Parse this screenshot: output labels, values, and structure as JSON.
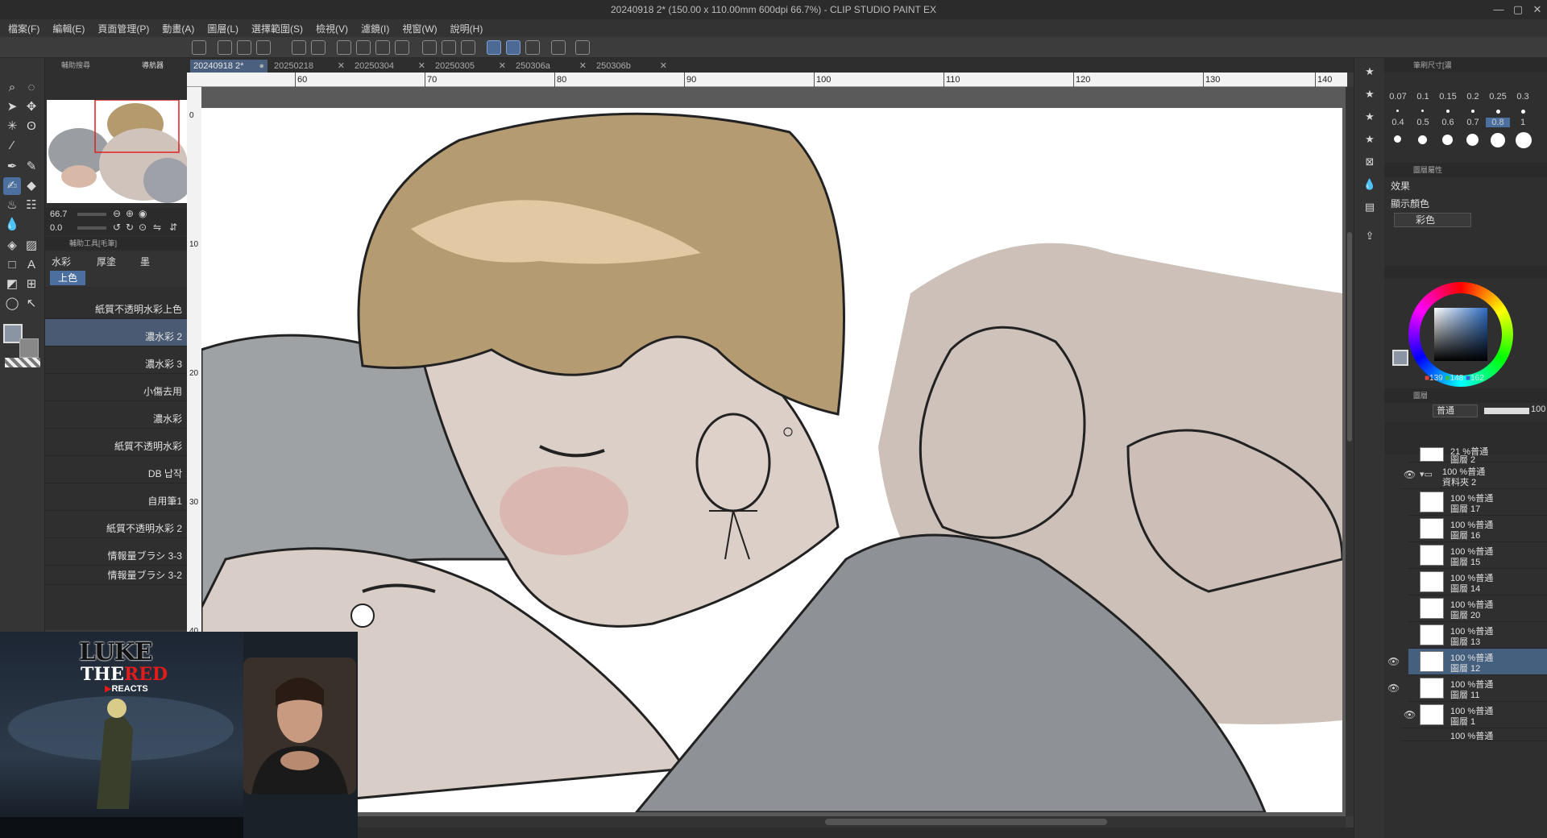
{
  "window": {
    "title": "20240918 2* (150.00 x 110.00mm 600dpi 66.7%) - CLIP STUDIO PAINT EX",
    "controls": [
      "—",
      "▢",
      "✕"
    ]
  },
  "menu": [
    "檔案(F)",
    "編輯(E)",
    "頁面管理(P)",
    "動畫(A)",
    "圖層(L)",
    "選擇範圍(S)",
    "檢視(V)",
    "濾鏡(I)",
    "視窗(W)",
    "說明(H)"
  ],
  "left_panel": {
    "tabs": [
      "輔助搜尋",
      "導航器"
    ],
    "navigator": {
      "zoom": "66.7",
      "rotation": "0.0"
    },
    "subtool_header": "輔助工具[毛筆]",
    "subtool_groups": [
      "水彩",
      "厚塗",
      "墨"
    ],
    "active_group": "上色",
    "brushes": [
      "紙質不透明水彩上色",
      "濃水彩 2",
      "濃水彩 3",
      "小傷去用",
      "濃水彩",
      "紙質不透明水彩",
      "DB 납작",
      "自用筆1",
      "紙質不透明水彩 2",
      "情報量ブラシ 3-3",
      "情報量ブラシ 3-2"
    ],
    "selected_brush_index": 1
  },
  "tabs": [
    {
      "label": "20240918 2*",
      "active": true
    },
    {
      "label": "20250218",
      "active": false
    },
    {
      "label": "20250304",
      "active": false
    },
    {
      "label": "20250305",
      "active": false
    },
    {
      "label": "250306a",
      "active": false
    },
    {
      "label": "250306b",
      "active": false
    }
  ],
  "ruler": {
    "h_ticks": [
      "60",
      "70",
      "80",
      "90",
      "100",
      "110",
      "120",
      "130",
      "140"
    ],
    "v_ticks": [
      "0",
      "10",
      "20",
      "30",
      "40"
    ]
  },
  "right_panel": {
    "brush_size_header": "筆刷尺寸[濃",
    "brush_sizes": [
      "0.07",
      "0.1",
      "0.15",
      "0.2",
      "0.25",
      "0.3",
      "0.4",
      "0.5",
      "0.6",
      "0.7",
      "0.8",
      "1"
    ],
    "selected_brush_size": "0.8",
    "layer_property_header": "圖層屬性",
    "effect_label": "效果",
    "display_color_label": "顯示顏色",
    "display_color_value": "彩色",
    "color": {
      "r": "139",
      "g": "148",
      "b": "162",
      "hex": "#8b94a2"
    },
    "layer_header": "圖層",
    "blend_mode": "普通",
    "opacity": "100",
    "layers": [
      {
        "line1": "21 %普通",
        "line2": "圖層 2",
        "visible": false,
        "indent": 1
      },
      {
        "line1": "100 %普通",
        "line2": "資料夾 2",
        "visible": true,
        "indent": 0,
        "folder": true
      },
      {
        "line1": "100 %普通",
        "line2": "圖層 17",
        "visible": false,
        "indent": 1
      },
      {
        "line1": "100 %普通",
        "line2": "圖層 16",
        "visible": false,
        "indent": 1
      },
      {
        "line1": "100 %普通",
        "line2": "圖層 15",
        "visible": false,
        "indent": 1
      },
      {
        "line1": "100 %普通",
        "line2": "圖層 14",
        "visible": false,
        "indent": 1
      },
      {
        "line1": "100 %普通",
        "line2": "圖層 20",
        "visible": false,
        "indent": 1
      },
      {
        "line1": "100 %普通",
        "line2": "圖層 13",
        "visible": false,
        "indent": 1
      },
      {
        "line1": "100 %普通",
        "line2": "圖層 12",
        "visible": true,
        "indent": 1,
        "selected": true
      },
      {
        "line1": "100 %普通",
        "line2": "圖層 11",
        "visible": true,
        "indent": 1
      },
      {
        "line1": "100 %普通",
        "line2": "圖層 1",
        "visible": true,
        "indent": 0
      },
      {
        "line1": "100 %普通",
        "line2": "",
        "visible": false,
        "indent": 0
      }
    ]
  },
  "overlay": {
    "logo_line1": "LUKE",
    "logo_line2": "THE",
    "logo_red": "RED",
    "logo_sub": "REACTS"
  }
}
